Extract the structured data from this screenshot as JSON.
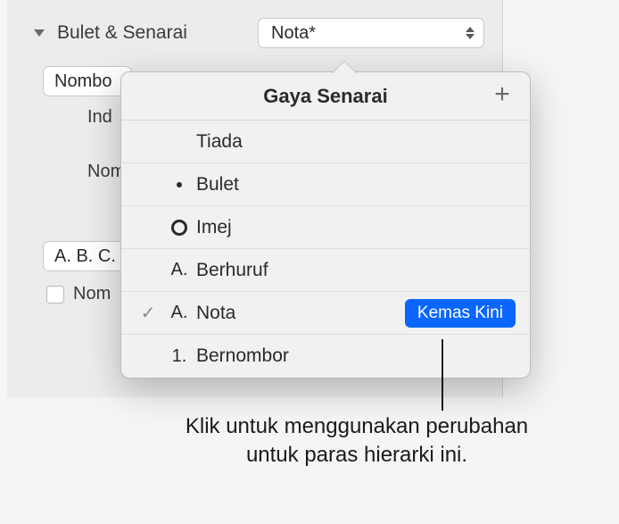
{
  "section": {
    "title": "Bulet & Senarai",
    "style_selected": "Nota*"
  },
  "type_select": {
    "value": "Nombo"
  },
  "labels": {
    "indent": "Ind",
    "number": "Nom",
    "checkbox_number": "Nom"
  },
  "format_select": {
    "value": "A. B. C."
  },
  "popover": {
    "title": "Gaya Senarai",
    "items": [
      {
        "marker": "",
        "marker_type": "none",
        "label": "Tiada",
        "selected": false
      },
      {
        "marker": "•",
        "marker_type": "dot",
        "label": "Bulet",
        "selected": false
      },
      {
        "marker": "○",
        "marker_type": "ring",
        "label": "Imej",
        "selected": false
      },
      {
        "marker": "A.",
        "marker_type": "text",
        "label": "Berhuruf",
        "selected": false
      },
      {
        "marker": "A.",
        "marker_type": "text",
        "label": "Nota",
        "selected": true,
        "update": "Kemas Kini"
      },
      {
        "marker": "1.",
        "marker_type": "text",
        "label": "Bernombor",
        "selected": false
      }
    ]
  },
  "callout": {
    "text": "Klik untuk menggunakan perubahan untuk paras hierarki ini."
  }
}
